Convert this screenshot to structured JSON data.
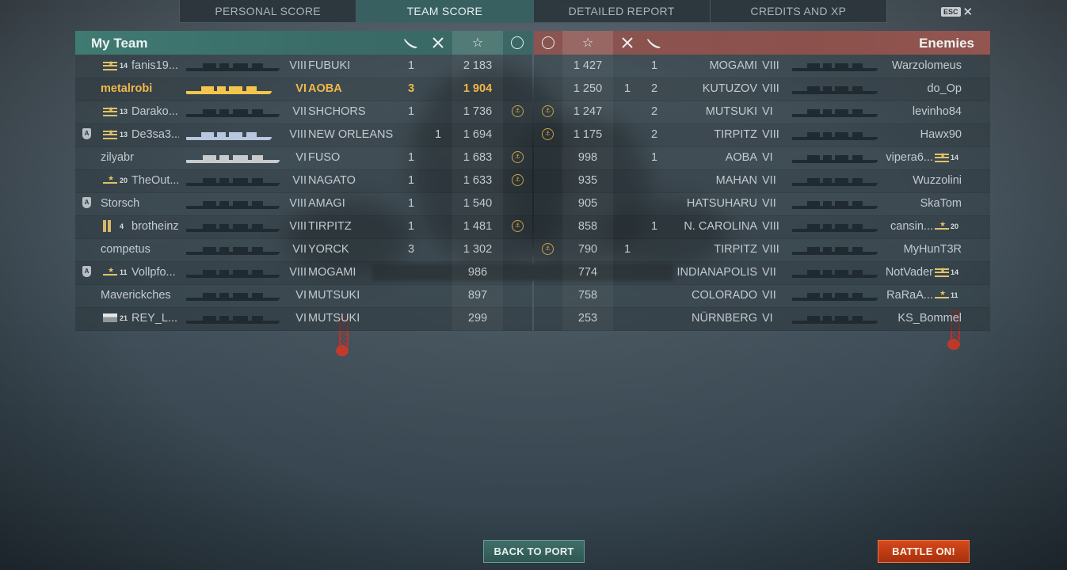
{
  "tabs": [
    {
      "label": "PERSONAL SCORE",
      "active": false
    },
    {
      "label": "TEAM SCORE",
      "active": true
    },
    {
      "label": "DETAILED REPORT",
      "active": false
    },
    {
      "label": "CREDITS AND XP",
      "active": false
    }
  ],
  "esc": {
    "key": "ESC",
    "close_icon": "close-icon"
  },
  "my_team": {
    "title": "My Team",
    "header_icons": [
      "torpedo-icon",
      "plane-icon",
      "star-icon",
      "medal-icon"
    ],
    "rows": [
      {
        "rank": 14,
        "insignia": "stripes",
        "player": "fanis19...",
        "tier": "VIII",
        "ship": "FUBUKI",
        "kills": "1",
        "planes": "",
        "score": "2 183",
        "medal": false,
        "clan": false,
        "me": false,
        "ship_color": "dark"
      },
      {
        "rank": null,
        "insignia": "",
        "player": "metalrobi",
        "tier": "VI",
        "ship": "AOBA",
        "kills": "3",
        "planes": "",
        "score": "1 904",
        "medal": false,
        "clan": false,
        "me": true,
        "ship_color": "me"
      },
      {
        "rank": 13,
        "insignia": "stripes",
        "player": "Darako...",
        "tier": "VII",
        "ship": "SHCHORS",
        "kills": "1",
        "planes": "",
        "score": "1 736",
        "medal": true,
        "clan": false,
        "me": false,
        "ship_color": "dark"
      },
      {
        "rank": 13,
        "insignia": "stripes",
        "player": "De3sa3...",
        "tier": "VIII",
        "ship": "NEW ORLEANS",
        "kills": "",
        "planes": "1",
        "score": "1 694",
        "medal": false,
        "clan": true,
        "me": false,
        "ship_color": "ally"
      },
      {
        "rank": null,
        "insignia": "",
        "player": "zilyabr",
        "tier": "VI",
        "ship": "FUSO",
        "kills": "1",
        "planes": "",
        "score": "1 683",
        "medal": true,
        "clan": false,
        "me": false,
        "ship_color": "light"
      },
      {
        "rank": 20,
        "insignia": "star",
        "player": "TheOut...",
        "tier": "VII",
        "ship": "NAGATO",
        "kills": "1",
        "planes": "",
        "score": "1 633",
        "medal": true,
        "clan": false,
        "me": false,
        "ship_color": "dark"
      },
      {
        "rank": null,
        "insignia": "",
        "player": "Storsch",
        "tier": "VIII",
        "ship": "AMAGI",
        "kills": "1",
        "planes": "",
        "score": "1 540",
        "medal": false,
        "clan": true,
        "me": false,
        "ship_color": "dark"
      },
      {
        "rank": 4,
        "insignia": "pillar",
        "player": "brotheinz",
        "tier": "VIII",
        "ship": "TIRPITZ",
        "kills": "1",
        "planes": "",
        "score": "1 481",
        "medal": true,
        "clan": false,
        "me": false,
        "ship_color": "dark"
      },
      {
        "rank": null,
        "insignia": "",
        "player": "competus",
        "tier": "VII",
        "ship": "YORCK",
        "kills": "3",
        "planes": "",
        "score": "1 302",
        "medal": false,
        "clan": false,
        "me": false,
        "ship_color": "dark"
      },
      {
        "rank": 11,
        "insignia": "star",
        "player": "Vollpfo...",
        "tier": "VIII",
        "ship": "MOGAMI",
        "kills": "",
        "planes": "",
        "score": "986",
        "medal": false,
        "clan": true,
        "me": false,
        "ship_color": "dark"
      },
      {
        "rank": null,
        "insignia": "",
        "player": "Maverickches",
        "tier": "VI",
        "ship": "MUTSUKI",
        "kills": "",
        "planes": "",
        "score": "897",
        "medal": false,
        "clan": false,
        "me": false,
        "ship_color": "dark"
      },
      {
        "rank": 21,
        "insignia": "flag",
        "player": "REY_L...",
        "tier": "VI",
        "ship": "MUTSUKI",
        "kills": "",
        "planes": "",
        "score": "299",
        "medal": false,
        "clan": false,
        "me": false,
        "ship_color": "dark"
      }
    ]
  },
  "enemies": {
    "title": "Enemies",
    "header_icons": [
      "medal-icon",
      "star-icon",
      "plane-icon",
      "torpedo-icon"
    ],
    "rows": [
      {
        "medal": false,
        "score": "1 427",
        "planes": "",
        "kills": "1",
        "ship": "MOGAMI",
        "tier": "VIII",
        "player": "Warzolomeus",
        "rank": null,
        "insignia": ""
      },
      {
        "medal": false,
        "score": "1 250",
        "planes": "1",
        "kills": "2",
        "ship": "KUTUZOV",
        "tier": "VIII",
        "player": "do_Op",
        "rank": null,
        "insignia": ""
      },
      {
        "medal": true,
        "score": "1 247",
        "planes": "",
        "kills": "2",
        "ship": "MUTSUKI",
        "tier": "VI",
        "player": "levinho84",
        "rank": null,
        "insignia": ""
      },
      {
        "medal": true,
        "score": "1 175",
        "planes": "",
        "kills": "2",
        "ship": "TIRPITZ",
        "tier": "VIII",
        "player": "Hawx90",
        "rank": null,
        "insignia": ""
      },
      {
        "medal": false,
        "score": "998",
        "planes": "",
        "kills": "1",
        "ship": "AOBA",
        "tier": "VI",
        "player": "vipera6...",
        "rank": 14,
        "insignia": "stripes"
      },
      {
        "medal": false,
        "score": "935",
        "planes": "",
        "kills": "",
        "ship": "MAHAN",
        "tier": "VII",
        "player": "Wuzzolini",
        "rank": null,
        "insignia": ""
      },
      {
        "medal": false,
        "score": "905",
        "planes": "",
        "kills": "",
        "ship": "HATSUHARU",
        "tier": "VII",
        "player": "SkaTom",
        "rank": null,
        "insignia": ""
      },
      {
        "medal": false,
        "score": "858",
        "planes": "",
        "kills": "1",
        "ship": "N. CAROLINA",
        "tier": "VIII",
        "player": "cansin...",
        "rank": 20,
        "insignia": "star"
      },
      {
        "medal": true,
        "score": "790",
        "planes": "1",
        "kills": "",
        "ship": "TIRPITZ",
        "tier": "VIII",
        "player": "MyHunT3R",
        "rank": null,
        "insignia": ""
      },
      {
        "medal": false,
        "score": "774",
        "planes": "",
        "kills": "",
        "ship": "INDIANAPOLIS",
        "tier": "VII",
        "player": "NotVader",
        "rank": 14,
        "insignia": "stripes"
      },
      {
        "medal": false,
        "score": "758",
        "planes": "",
        "kills": "",
        "ship": "COLORADO",
        "tier": "VII",
        "player": "RaRaA...",
        "rank": 11,
        "insignia": "star"
      },
      {
        "medal": false,
        "score": "253",
        "planes": "",
        "kills": "",
        "ship": "NÜRNBERG",
        "tier": "VI",
        "player": "KS_Bommel",
        "rank": null,
        "insignia": ""
      }
    ]
  },
  "buttons": {
    "back_to_port": "BACK TO PORT",
    "battle_on": "BATTLE ON!"
  },
  "colors": {
    "my_team_header": "#3f7a73",
    "enemy_header": "#8a5450",
    "self_highlight": "#f0b84a",
    "battle_button": "#d6481c"
  }
}
